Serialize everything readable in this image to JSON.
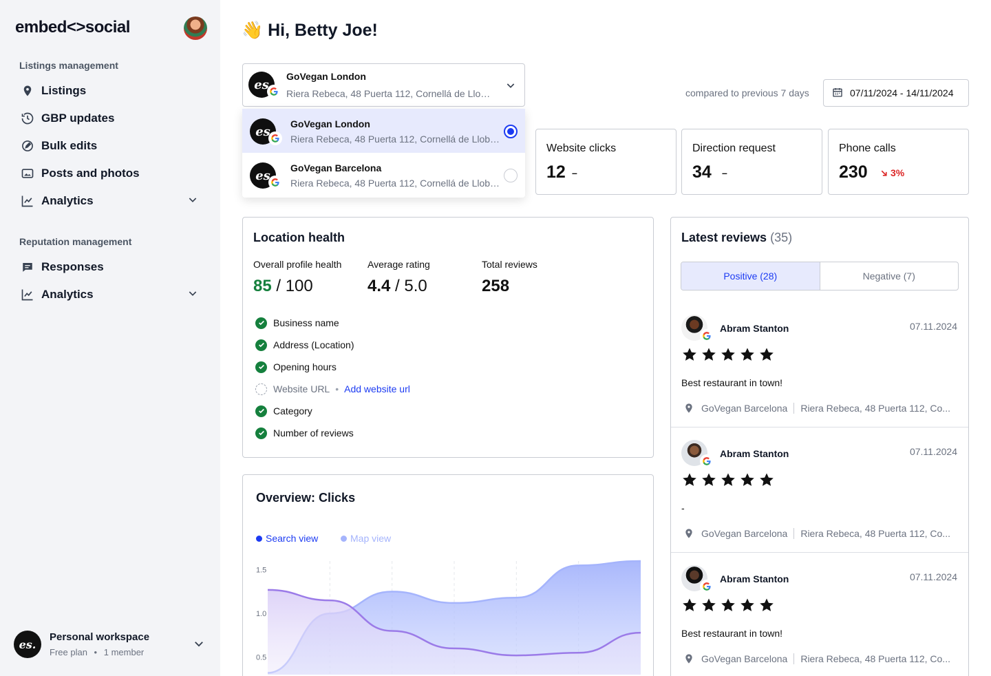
{
  "brand": {
    "logo_text": "embed<>social"
  },
  "sidebar": {
    "section1": "Listings management",
    "section1_items": [
      {
        "label": "Listings",
        "icon": "map-pin-icon"
      },
      {
        "label": "GBP updates",
        "icon": "history-icon"
      },
      {
        "label": "Bulk edits",
        "icon": "edit-circle-icon"
      },
      {
        "label": "Posts and photos",
        "icon": "photos-icon"
      },
      {
        "label": "Analytics",
        "icon": "chart-line-icon"
      }
    ],
    "section2": "Reputation management",
    "section2_items": [
      {
        "label": "Responses",
        "icon": "message-icon"
      },
      {
        "label": "Analytics",
        "icon": "chart-line-icon"
      }
    ],
    "workspace": {
      "name": "Personal workspace",
      "plan": "Free plan",
      "members": "1 member",
      "logo": "es."
    }
  },
  "greeting": {
    "emoji": "👋",
    "text": "Hi, Betty Joe!"
  },
  "location_select": {
    "title": "GoVegan London",
    "address": "Riera Rebeca, 48 Puerta 112, Cornellá de Llobregat",
    "options": [
      {
        "title": "GoVegan London",
        "address": "Riera Rebeca, 48 Puerta 112, Cornellá de Llobregat",
        "selected": true
      },
      {
        "title": "GoVegan Barcelona",
        "address": "Riera Rebeca, 48 Puerta 112, Cornellá de Llobregat",
        "selected": false
      }
    ]
  },
  "date": {
    "compare_text": "compared to previous 7 days",
    "range": "07/11/2024 - 14/11/2024"
  },
  "stats": [
    {
      "label": "Website clicks",
      "value": "12",
      "change": "–"
    },
    {
      "label": "Direction request",
      "value": "34",
      "change": "–"
    },
    {
      "label": "Phone calls",
      "value": "230",
      "change": "3%",
      "trend": "down"
    }
  ],
  "health": {
    "title": "Location health",
    "overall_label": "Overall profile health",
    "overall_value": "85",
    "overall_max": " / 100",
    "rating_label": "Average rating",
    "rating_value": "4.4",
    "rating_max": " / 5.0",
    "reviews_label": "Total reviews",
    "reviews_value": "258",
    "checks": [
      {
        "label": "Business name",
        "done": true
      },
      {
        "label": "Address (Location)",
        "done": true
      },
      {
        "label": "Opening hours",
        "done": true
      },
      {
        "label": "Website URL",
        "done": false,
        "action": "Add website url"
      },
      {
        "label": "Category",
        "done": true
      },
      {
        "label": "Number of reviews",
        "done": true
      }
    ]
  },
  "overview": {
    "title": "Overview: Clicks",
    "legend": [
      "Search view",
      "Map view"
    ],
    "colors": {
      "search": "#1c3bf2",
      "map": "#a5b4fc"
    }
  },
  "chart_data": {
    "type": "area",
    "x": [
      0,
      1,
      2,
      3,
      4,
      5,
      6
    ],
    "yticks": [
      "1.5",
      "1.0",
      "0.5"
    ],
    "ylim": [
      0.3,
      1.6
    ],
    "series": [
      {
        "name": "Search view",
        "values": [
          0.32,
          1.0,
          1.25,
          1.12,
          1.18,
          1.55,
          1.6
        ]
      },
      {
        "name": "Map view",
        "values": [
          1.27,
          1.15,
          0.8,
          0.6,
          0.52,
          0.55,
          0.78
        ]
      }
    ]
  },
  "reviews": {
    "title": "Latest reviews",
    "count": "(35)",
    "tabs": [
      "Positive (28)",
      "Negative (7)"
    ],
    "items": [
      {
        "name": "Abram Stanton",
        "date": "07.11.2024",
        "stars": 5,
        "text": "Best restaurant in town!",
        "location": "GoVegan Barcelona",
        "address": "Riera Rebeca, 48 Puerta 112, Co..."
      },
      {
        "name": "Abram Stanton",
        "date": "07.11.2024",
        "stars": 5,
        "text": "-",
        "location": "GoVegan Barcelona",
        "address": "Riera Rebeca, 48 Puerta 112, Co..."
      },
      {
        "name": "Abram Stanton",
        "date": "07.11.2024",
        "stars": 5,
        "text": "Best restaurant in town!",
        "location": "GoVegan Barcelona",
        "address": "Riera Rebeca, 48 Puerta 112, Co..."
      }
    ]
  }
}
